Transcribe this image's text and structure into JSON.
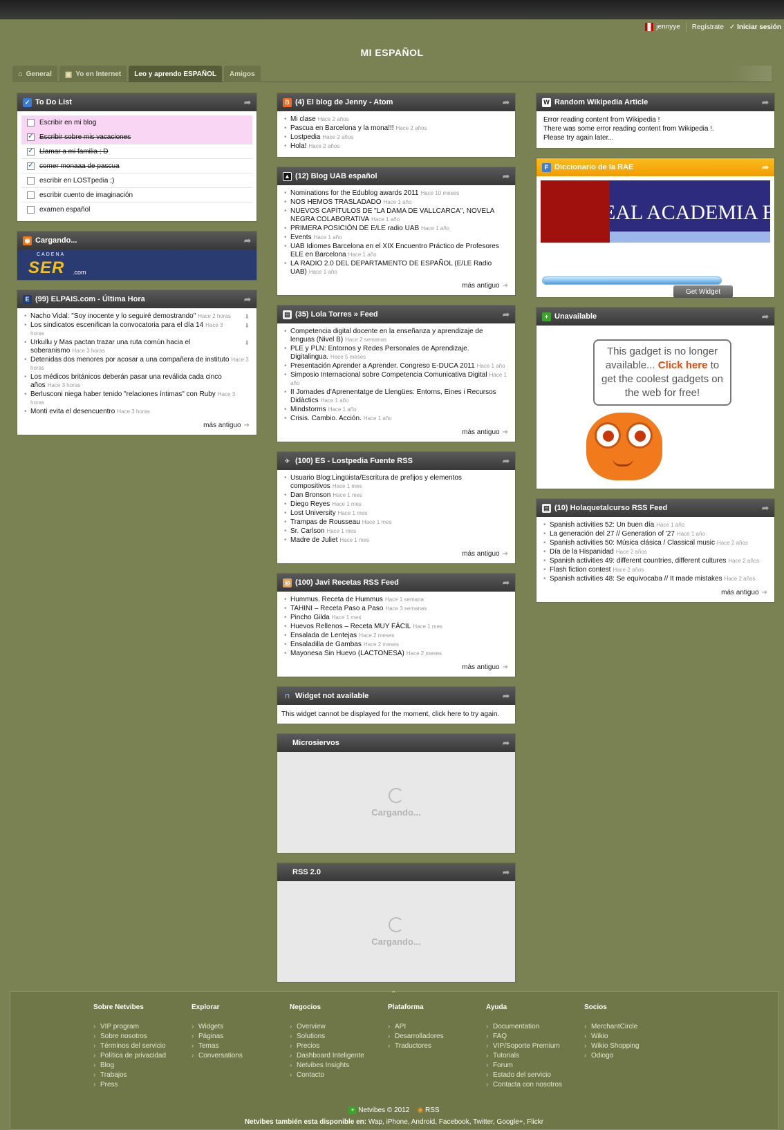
{
  "header": {
    "user": "jennyye",
    "register": "Regístrate",
    "login": "Iniciar sesión",
    "title": "MI ESPAÑOL"
  },
  "tabs": [
    {
      "label": "General",
      "icon": "home-icon"
    },
    {
      "label": "Yo en Internet",
      "icon": "id-card-icon"
    },
    {
      "label": "Leo y aprendo ESPAÑOL",
      "icon": ""
    },
    {
      "label": "Amigos",
      "icon": ""
    }
  ],
  "todo": {
    "title": "To Do List",
    "items": [
      {
        "text": "Escribir en mi blog",
        "checked": false
      },
      {
        "text": "Escribir sobre mis vacaciones",
        "checked": true
      },
      {
        "text": "Llamar a mi familia ; D",
        "checked": true
      },
      {
        "text": "comer monaaa de pascua",
        "checked": true
      },
      {
        "text": "escribir en LOSTpedia ;)",
        "checked": false
      },
      {
        "text": "escribir cuento de imaginación",
        "checked": false
      },
      {
        "text": "examen español",
        "checked": false
      }
    ]
  },
  "cargando": {
    "title": "Cargando...",
    "cadena": "CADENA",
    "logo": "SER",
    "com": ".com"
  },
  "elpais": {
    "title": "(99)  ELPAIS.com - Última Hora",
    "items": [
      {
        "text": "Nacho Vidal: \"Soy inocente y lo seguiré demostrando\"",
        "age": "Hace 2 horas"
      },
      {
        "text": "Los sindicatos escenifican la convocatoria para el día 14",
        "age": "Hace 3 horas"
      },
      {
        "text": "Urkullu y Mas pactan trazar una ruta común hacia el soberanismo",
        "age": "Hace 3 horas"
      },
      {
        "text": "Detenidas dos menores por acosar a una compañera de instituto",
        "age": "Hace 3 horas"
      },
      {
        "text": "Los médicos británicos deberán pasar una reválida cada cinco años",
        "age": "Hace 3 horas"
      },
      {
        "text": "Berlusconi niega haber tenido \"relaciones íntimas\" con Ruby",
        "age": "Hace 3 horas"
      },
      {
        "text": "Monti evita el desencuentro",
        "age": "Hace 3 horas"
      }
    ],
    "more": "más antiguo"
  },
  "blog_jenny": {
    "title": "(4)  El blog de Jenny - Atom",
    "items": [
      {
        "text": "Mi clase",
        "age": "Hace 2 años"
      },
      {
        "text": "Pascua en Barcelona y la mona!!!",
        "age": "Hace 2 años"
      },
      {
        "text": "Lostpedia",
        "age": "Hace 2 años"
      },
      {
        "text": "Hola!",
        "age": "Hace 2 años"
      }
    ]
  },
  "blog_uab": {
    "title": "(12)  Blog UAB español",
    "items": [
      {
        "text": "Nominations for the Edublog awards 2011",
        "age": "Hace 10 meses"
      },
      {
        "text": "NOS HEMOS TRASLADADO",
        "age": "Hace 1 año"
      },
      {
        "text": "NUEVOS CAPÍTULOS DE \"LA DAMA DE VALLCARCA\", NOVELA NEGRA COLABORATIVA",
        "age": "Hace 1 año"
      },
      {
        "text": "PRIMERA POSICIÓN DE E/LE radio UAB",
        "age": "Hace 1 año"
      },
      {
        "text": "Events",
        "age": "Hace 1 año"
      },
      {
        "text": "UAB Idiomes Barcelona en el XIX Encuentro Práctico de Profesores ELE en Barcelona",
        "age": "Hace 1 año"
      },
      {
        "text": "LA RADIO 2.0 DEL DEPARTAMENTO DE ESPAÑOL (E/LE Radio UAB)",
        "age": "Hace 1 año"
      }
    ],
    "more": "más antiguo"
  },
  "lola": {
    "title": "(35)  Lola Torres » Feed",
    "items": [
      {
        "text": "Competencia digital docente en la enseñanza y aprendizaje de lenguas (Nivel B)",
        "age": "Hace 2 semanas"
      },
      {
        "text": "PLE y PLN: Entornos y Redes Personales de Aprendizaje. Digitalingua.",
        "age": "Hace 5 meses"
      },
      {
        "text": "Presentación Aprender a Aprender. Congreso E-DUCA 2011",
        "age": "Hace 1 año"
      },
      {
        "text": "Simposio Internacional sobre Competencia Comunicativa Digital",
        "age": "Hace 1 año"
      },
      {
        "text": "II Jornades d'Aprenentatge de Llengües: Entorns, Eines i Recursos Didàctics",
        "age": "Hace 1 año"
      },
      {
        "text": "Mindstorms",
        "age": "Hace 1 año"
      },
      {
        "text": "Crisis. Cambio. Acción.",
        "age": "Hace 1 año"
      }
    ],
    "more": "más antiguo"
  },
  "lostpedia": {
    "title": "(100)  ES - Lostpedia Fuente RSS",
    "items": [
      {
        "text": "Usuario Blog:Lingüista/Escritura de prefijos y elementos compositivos",
        "age": "Hace 1 mes"
      },
      {
        "text": "Dan Bronson",
        "age": "Hace 1 mes"
      },
      {
        "text": "Diego Reyes",
        "age": "Hace 1 mes"
      },
      {
        "text": "Lost University",
        "age": "Hace 1 mes"
      },
      {
        "text": "Trampas de Rousseau",
        "age": "Hace 1 mes"
      },
      {
        "text": "Sr. Carlson",
        "age": "Hace 1 mes"
      },
      {
        "text": "Madre de Juliet",
        "age": "Hace 1 mes"
      }
    ],
    "more": "más antiguo"
  },
  "javi": {
    "title": "(100)  Javi Recetas RSS Feed",
    "items": [
      {
        "text": "Hummus. Receta de Hummus",
        "age": "Hace 1 semana"
      },
      {
        "text": "TAHINI – Receta Paso a Paso",
        "age": "Hace 3 semanas"
      },
      {
        "text": "Pincho Gilda",
        "age": "Hace 1 mes"
      },
      {
        "text": "Huevos Rellenos – Receta MUY FÁCIL",
        "age": "Hace 1 mes"
      },
      {
        "text": "Ensalada de Lentejas",
        "age": "Hace 2 meses"
      },
      {
        "text": "Ensaladilla de Gambas",
        "age": "Hace 2 meses"
      },
      {
        "text": "Mayonesa Sin Huevo (LACTONESA)",
        "age": "Hace 2 meses"
      }
    ],
    "more": "más antiguo"
  },
  "na_widget": {
    "title": "Widget not available",
    "text": "This widget cannot be displayed for the moment, click here to try again."
  },
  "microsiervos": {
    "title": "Microsiervos",
    "loading": "Cargando..."
  },
  "rss20": {
    "title": "RSS 2.0",
    "loading": "Cargando..."
  },
  "wikipedia": {
    "title": "Random Wikipedia Article",
    "lines": [
      "Error reading content from Wikipedia !",
      "There was some error reading content from Wikipedia !.",
      "Please try again later..."
    ]
  },
  "rae": {
    "title": "Diccionario de la RAE",
    "banner": "REAL ACADEMIA E",
    "button": "Get Widget"
  },
  "unavailable": {
    "title": "Unavailable",
    "text1": "This gadget is no longer available...",
    "link": "Click here",
    "text2": "to get the coolest gadgets on the web for free!"
  },
  "holaque": {
    "title": "(10)  Holaquetalcurso RSS Feed",
    "items": [
      {
        "text": "Spanish activities 52: Un buen día",
        "age": "Hace 1 año"
      },
      {
        "text": "La generación del 27 // Generation of '27",
        "age": "Hace 1 año"
      },
      {
        "text": "Spanish activities 50: Música clásica / Classical music",
        "age": "Hace 2 años"
      },
      {
        "text": "Día de la Hispanidad",
        "age": "Hace 2 años"
      },
      {
        "text": "Spanish activities 49: different countries, different cultures",
        "age": "Hace 2 años"
      },
      {
        "text": "Flash fiction contest",
        "age": "Hace 2 años"
      },
      {
        "text": "Spanish activities 48: Se equivocaba // It made mistakes",
        "age": "Hace 2 años"
      }
    ],
    "more": "más antiguo"
  },
  "footer": {
    "columns": [
      {
        "title": "Sobre Netvibes",
        "links": [
          "VIP program",
          "Sobre nosotros",
          "Términos del servicio",
          "Política de privacidad",
          "Blog",
          "Trabajos",
          "Press"
        ]
      },
      {
        "title": "Explorar",
        "links": [
          "Widgets",
          "Páginas",
          "Temas",
          "Conversations"
        ]
      },
      {
        "title": "Negocios",
        "links": [
          "Overview",
          "Solutions",
          "Precios",
          "Dashboard Inteligente",
          "Netvibes Insights",
          "Contacto"
        ]
      },
      {
        "title": "Plataforma",
        "links": [
          "API",
          "Desarrolladores",
          "Traductores"
        ]
      },
      {
        "title": "Ayuda",
        "links": [
          "Documentation",
          "FAQ",
          "VIP/Soporte Premium",
          "Tutorials",
          "Forum",
          "Estado del servicio",
          "Contacta con nosotros"
        ]
      },
      {
        "title": "Socios",
        "links": [
          "MerchantCircle",
          "Wikio",
          "Wikio Shopping",
          "Odiogo"
        ]
      }
    ],
    "copyright": "Netvibes © 2012",
    "rss": "RSS",
    "also_label": "Netvibes también esta disponible en:",
    "also_list": "Wap, iPhone, Android, Facebook, Twitter, Google+, Flickr"
  },
  "colors": {
    "background": "#7a8254",
    "widget_header": "#444444",
    "rae_header": "#f5a800",
    "todo_highlight": "#f9d7f4"
  }
}
